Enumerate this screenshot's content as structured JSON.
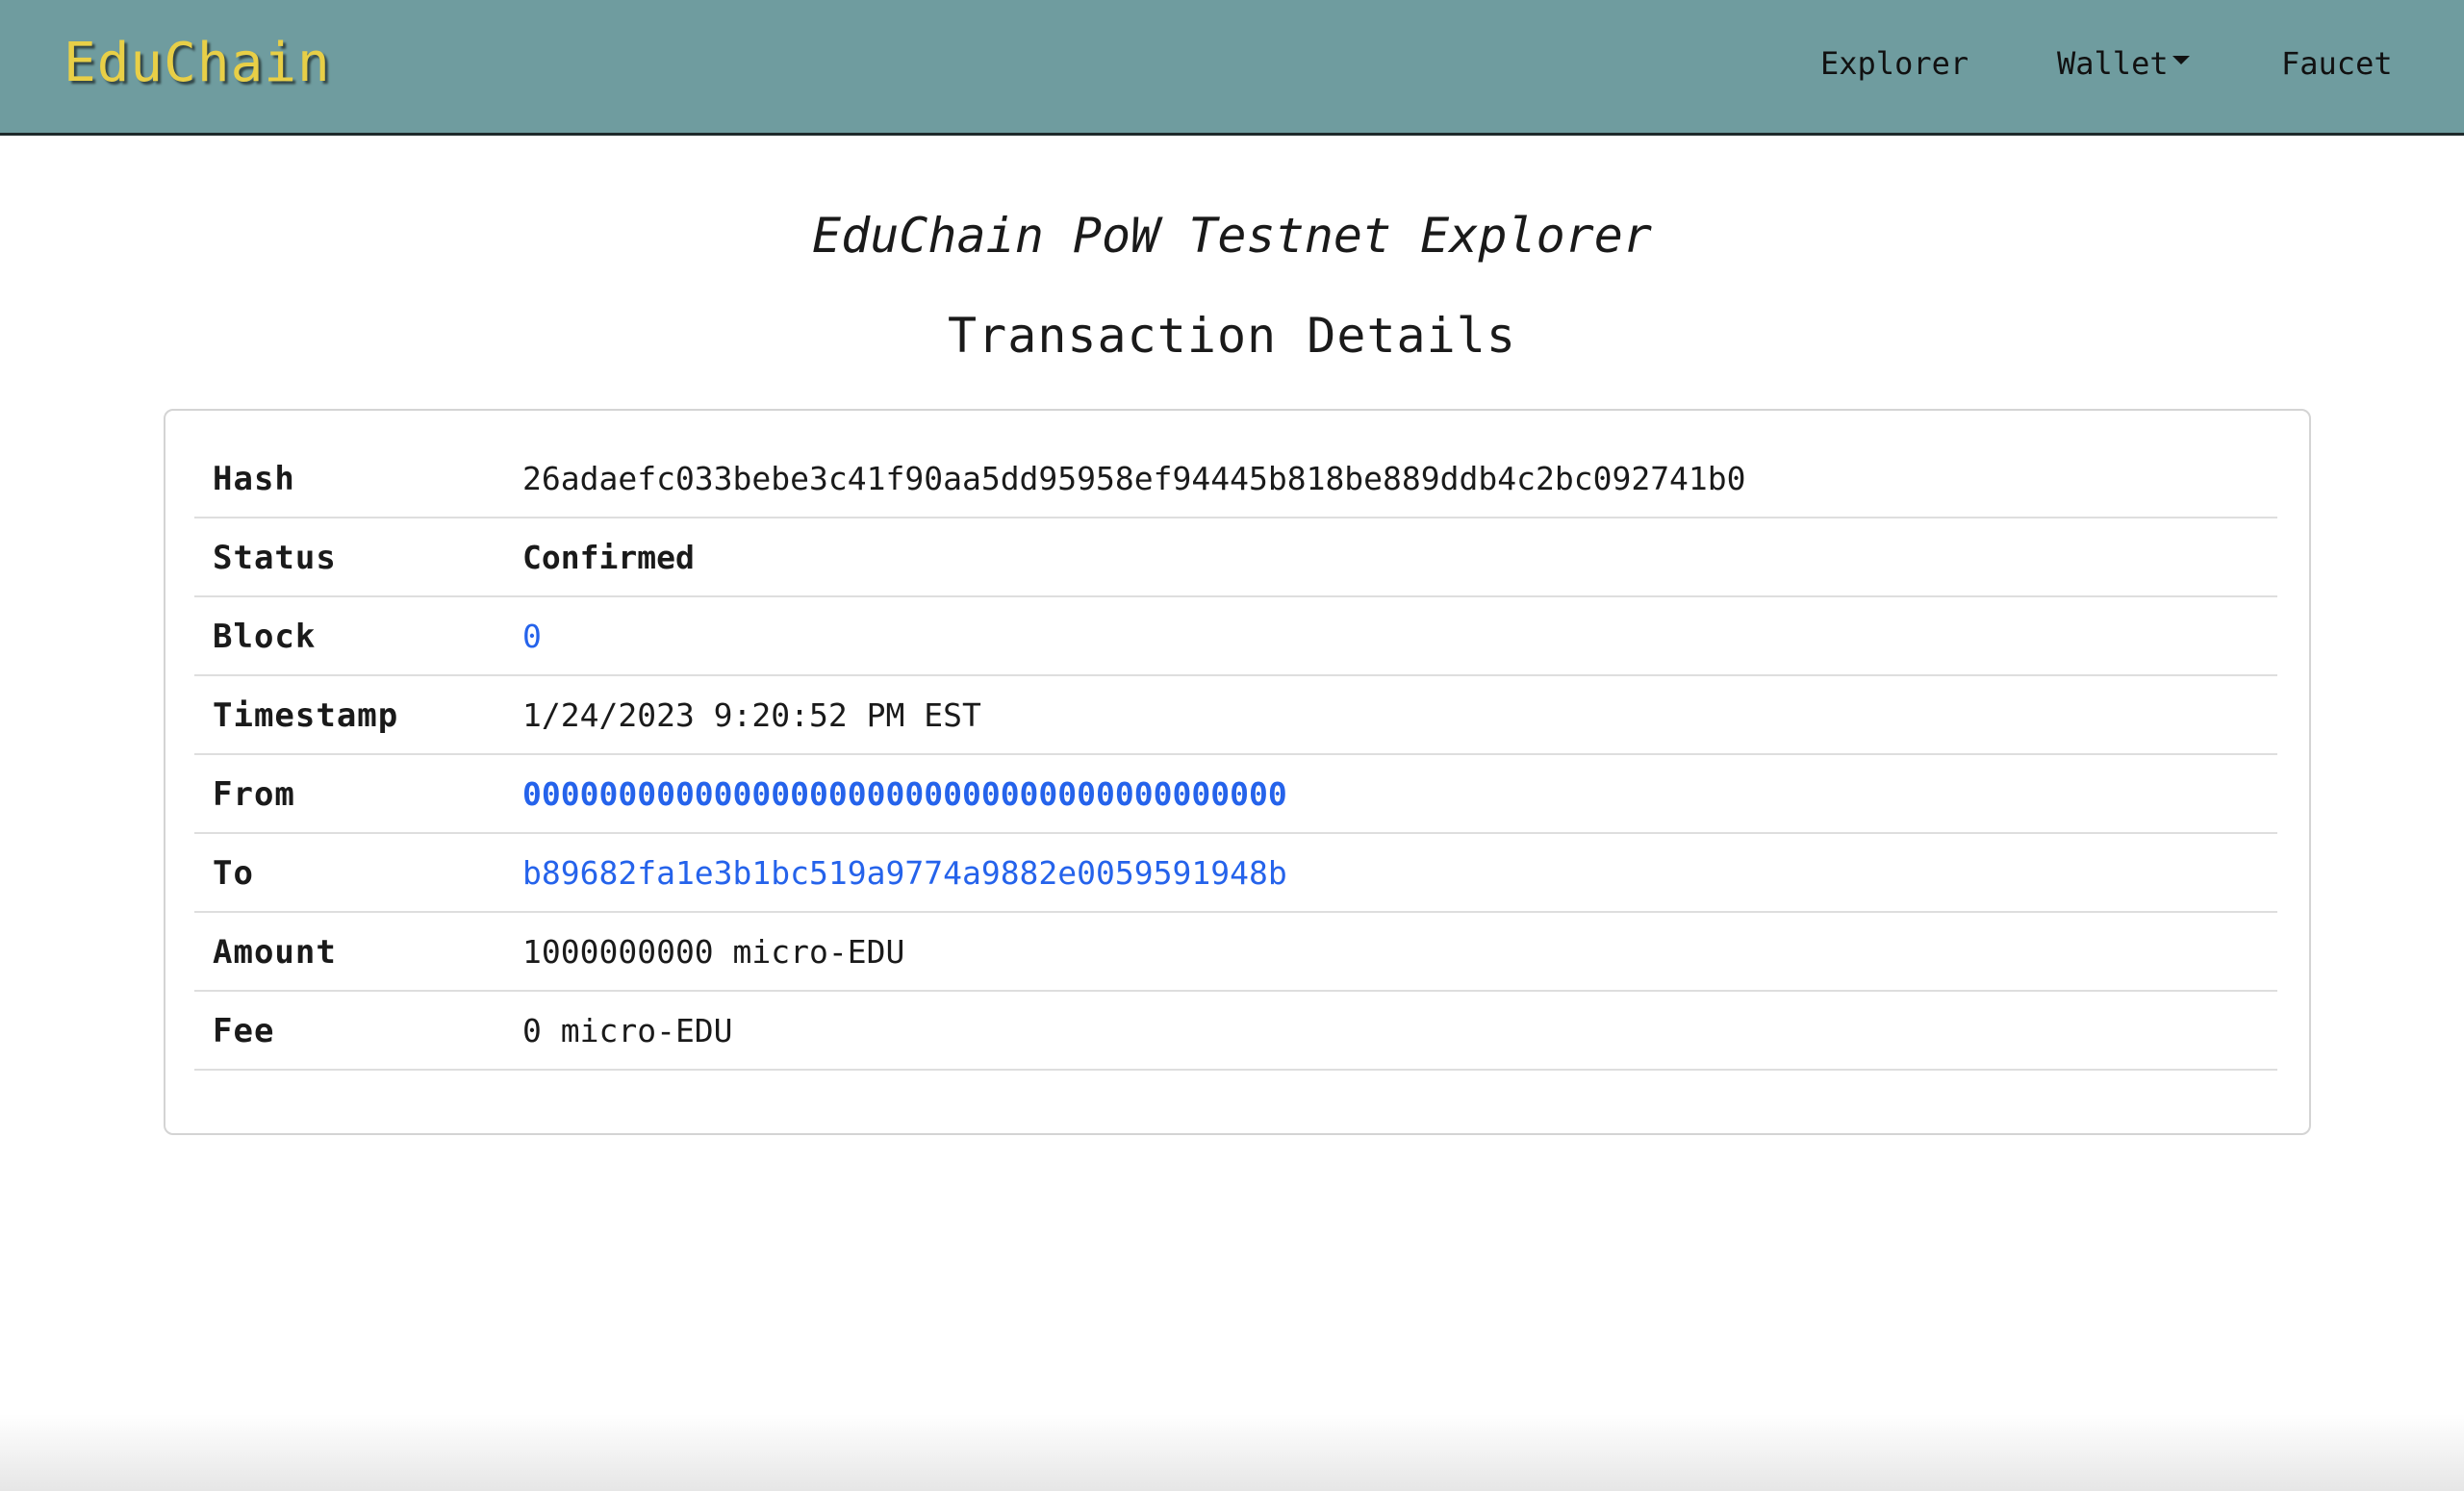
{
  "navbar": {
    "brand": "EduChain",
    "links": {
      "explorer": "Explorer",
      "wallet": "Wallet",
      "faucet": "Faucet"
    },
    "colors": {
      "background": "#6f9c9f",
      "brand": "#e8cf47"
    }
  },
  "page": {
    "subtitle": "EduChain PoW Testnet Explorer",
    "heading": "Transaction Details"
  },
  "transaction": {
    "hash": {
      "label": "Hash",
      "value": "26adaefc033bebe3c41f90aa5dd95958ef94445b818be889ddb4c2bc092741b0"
    },
    "status": {
      "label": "Status",
      "value": "Confirmed"
    },
    "block": {
      "label": "Block",
      "value": "0"
    },
    "timestamp": {
      "label": "Timestamp",
      "value": "1/24/2023 9:20:52 PM EST"
    },
    "from": {
      "label": "From",
      "value": "0000000000000000000000000000000000000000"
    },
    "to": {
      "label": "To",
      "value": "b89682fa1e3b1bc519a9774a9882e0059591948b"
    },
    "amount": {
      "label": "Amount",
      "value": "1000000000 micro-EDU"
    },
    "fee": {
      "label": "Fee",
      "value": "0 micro-EDU"
    }
  },
  "colors": {
    "link": "#2563eb"
  }
}
